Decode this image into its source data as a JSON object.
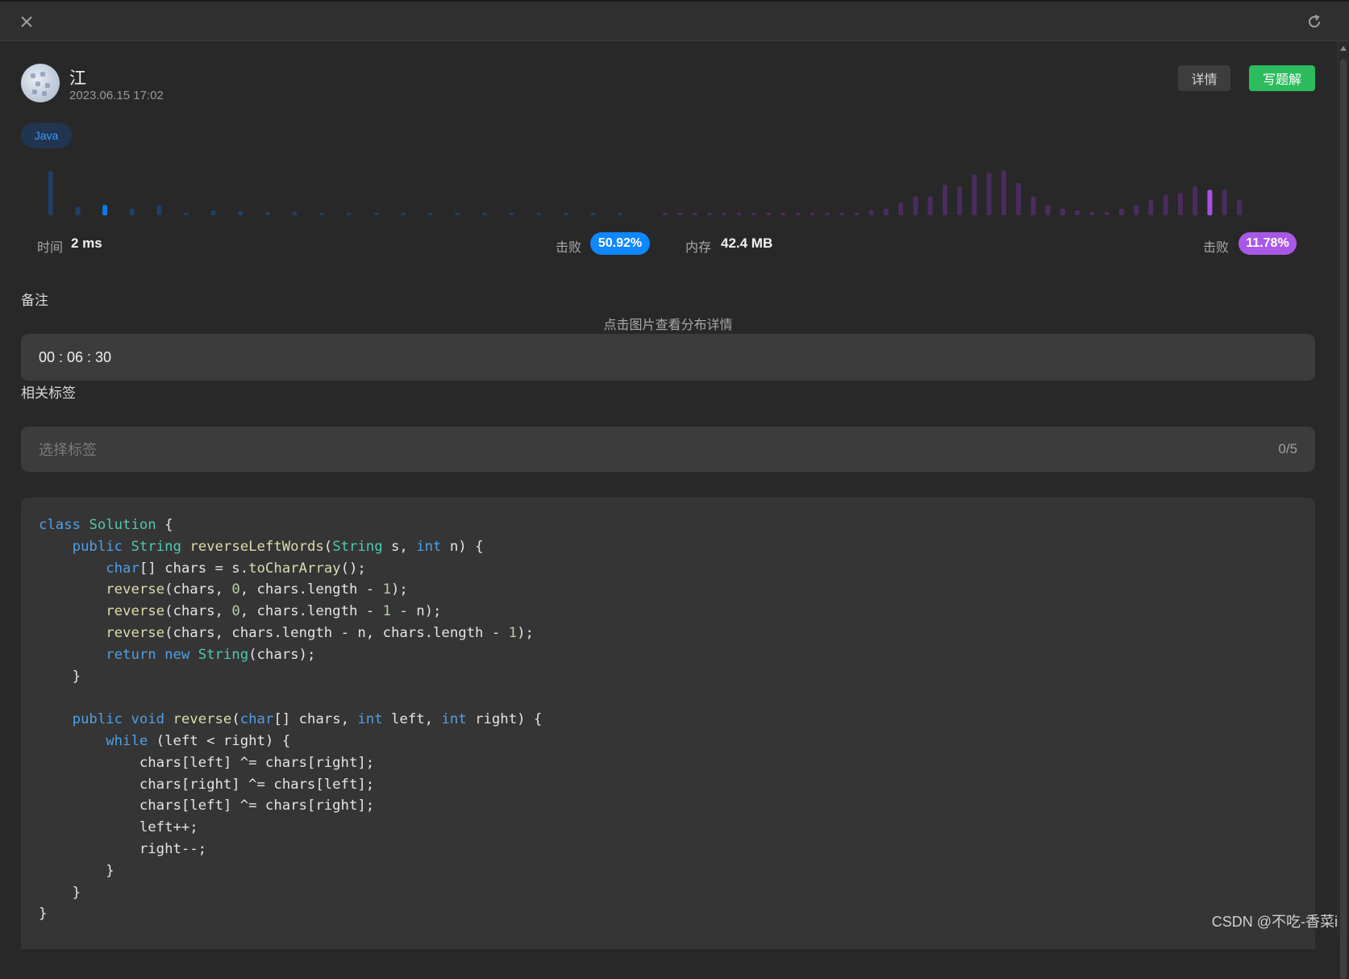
{
  "topbar": {
    "close_icon": "close-icon",
    "refresh_icon": "refresh-icon"
  },
  "submission": {
    "user_name": "江",
    "timestamp": "2023.06.15 17:02",
    "detail_button": "详情",
    "write_solution_button": "写题解",
    "language": "Java"
  },
  "stats": {
    "time_label": "时间",
    "time_value": "2 ms",
    "time_beat_label": "击败",
    "time_beat_pct": "50.92%",
    "memory_label": "内存",
    "memory_value": "42.4 MB",
    "memory_beat_label": "击败",
    "memory_beat_pct": "11.78%",
    "hint": "点击图片查看分布详情",
    "colors": {
      "time_bar": "#1f3f66",
      "time_highlight": "#0f7ae5",
      "memory_bar": "#4a2c5e",
      "memory_highlight": "#a64fe6",
      "time_badge": "#0f87ff",
      "memory_badge": "#a858e6"
    }
  },
  "chart_data": [
    {
      "type": "bar",
      "series": "runtime distribution",
      "values": [
        52,
        10,
        12,
        8,
        12,
        3,
        6,
        5,
        4,
        4,
        3,
        3,
        3,
        3,
        3,
        3,
        3,
        3,
        3,
        3,
        3,
        3
      ],
      "highlight_index": 2
    },
    {
      "type": "bar",
      "series": "memory distribution",
      "values": [
        3,
        3,
        3,
        3,
        3,
        3,
        3,
        3,
        3,
        3,
        3,
        3,
        3,
        3,
        6,
        8,
        15,
        22,
        22,
        36,
        34,
        48,
        50,
        53,
        38,
        22,
        12,
        8,
        6,
        4,
        4,
        8,
        12,
        18,
        24,
        26,
        34,
        30,
        30,
        18
      ],
      "highlight_index": 37
    }
  ],
  "note": {
    "title": "备注",
    "value": "00 : 06 : 30"
  },
  "tags": {
    "title": "相关标签",
    "placeholder": "选择标签",
    "count": "0/5"
  },
  "code": {
    "lines": [
      [
        [
          "kw",
          "class "
        ],
        [
          "ty",
          "Solution"
        ],
        [
          "pl",
          " {"
        ]
      ],
      [
        [
          "pl",
          "    "
        ],
        [
          "kw",
          "public "
        ],
        [
          "ty",
          "String "
        ],
        [
          "fn",
          "reverseLeftWords"
        ],
        [
          "pl",
          "("
        ],
        [
          "ty",
          "String"
        ],
        [
          "pl",
          " s, "
        ],
        [
          "kw",
          "int"
        ],
        [
          "pl",
          " n) {"
        ]
      ],
      [
        [
          "pl",
          "        "
        ],
        [
          "kw",
          "char"
        ],
        [
          "pl",
          "[] chars = s."
        ],
        [
          "fn",
          "toCharArray"
        ],
        [
          "pl",
          "();"
        ]
      ],
      [
        [
          "pl",
          "        "
        ],
        [
          "fn",
          "reverse"
        ],
        [
          "pl",
          "(chars, "
        ],
        [
          "num",
          "0"
        ],
        [
          "pl",
          ", chars.length - "
        ],
        [
          "num",
          "1"
        ],
        [
          "pl",
          ");"
        ]
      ],
      [
        [
          "pl",
          "        "
        ],
        [
          "fn",
          "reverse"
        ],
        [
          "pl",
          "(chars, "
        ],
        [
          "num",
          "0"
        ],
        [
          "pl",
          ", chars.length - "
        ],
        [
          "num",
          "1"
        ],
        [
          "pl",
          " - n);"
        ]
      ],
      [
        [
          "pl",
          "        "
        ],
        [
          "fn",
          "reverse"
        ],
        [
          "pl",
          "(chars, chars.length - n, chars.length - "
        ],
        [
          "num",
          "1"
        ],
        [
          "pl",
          ");"
        ]
      ],
      [
        [
          "pl",
          "        "
        ],
        [
          "kw",
          "return new "
        ],
        [
          "ty",
          "String"
        ],
        [
          "pl",
          "(chars);"
        ]
      ],
      [
        [
          "pl",
          "    }"
        ]
      ],
      [
        [
          "pl",
          ""
        ]
      ],
      [
        [
          "pl",
          "    "
        ],
        [
          "kw",
          "public void "
        ],
        [
          "fn",
          "reverse"
        ],
        [
          "pl",
          "("
        ],
        [
          "kw",
          "char"
        ],
        [
          "pl",
          "[] chars, "
        ],
        [
          "kw",
          "int"
        ],
        [
          "pl",
          " left, "
        ],
        [
          "kw",
          "int"
        ],
        [
          "pl",
          " right) {"
        ]
      ],
      [
        [
          "pl",
          "        "
        ],
        [
          "kw",
          "while"
        ],
        [
          "pl",
          " (left < right) {"
        ]
      ],
      [
        [
          "pl",
          "            chars[left] ^= chars[right];"
        ]
      ],
      [
        [
          "pl",
          "            chars[right] ^= chars[left];"
        ]
      ],
      [
        [
          "pl",
          "            chars[left] ^= chars[right];"
        ]
      ],
      [
        [
          "pl",
          "            left++;"
        ]
      ],
      [
        [
          "pl",
          "            right--;"
        ]
      ],
      [
        [
          "pl",
          "        }"
        ]
      ],
      [
        [
          "pl",
          "    }"
        ]
      ],
      [
        [
          "pl",
          "}"
        ]
      ]
    ]
  },
  "watermark": "CSDN @不吃-香菜i"
}
